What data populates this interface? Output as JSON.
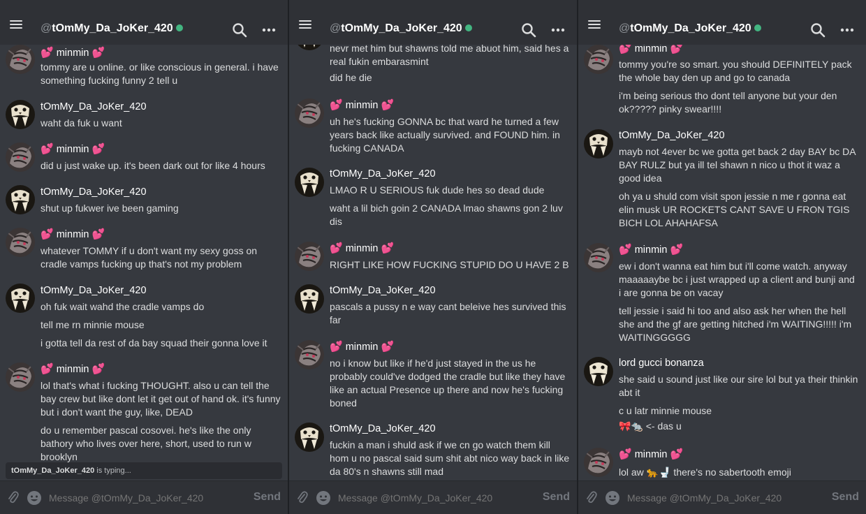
{
  "colors": {
    "background": "#36393f",
    "topbar": "#2f3136",
    "online": "#43b581",
    "heart": "#ff5ab0"
  },
  "header": {
    "at": "@",
    "username": "tOmMy_Da_JoKer_420",
    "status": "online"
  },
  "composer": {
    "placeholder": "Message @tOmMy_Da_JoKer_420",
    "send_label": "Send"
  },
  "panels": [
    {
      "typing": {
        "name": "tOmMy_Da_JoKer_420",
        "text": " is typing..."
      },
      "messages": [
        {
          "author": "minmin",
          "heart": "💕",
          "lines": [
            "tommy are u online. or like conscious in general. i have something fucking funny 2 tell u"
          ]
        },
        {
          "author": "tOmMy_Da_JoKer_420",
          "lines": [
            "waht da fuk u want"
          ]
        },
        {
          "author": "minmin",
          "heart": "💕",
          "lines": [
            "did u just wake up. it's been dark out for like 4 hours"
          ]
        },
        {
          "author": "tOmMy_Da_JoKer_420",
          "lines": [
            "shut up fukwer ive been gaming"
          ]
        },
        {
          "author": "minmin",
          "heart": "💕",
          "lines": [
            "whatever TOMMY if u don't want my sexy goss on cradle vamps fucking up that's not my problem"
          ]
        },
        {
          "author": "tOmMy_Da_JoKer_420",
          "lines": [
            "oh fuk wait wahd the cradle vamps do",
            "tell me rn minnie mouse",
            "i gotta tell da rest of da bay squad their gonna love it"
          ]
        },
        {
          "author": "minmin",
          "heart": "💕",
          "lines": [
            "lol that's what i fucking THOUGHT. also u can tell the bay crew but like dont let it get out of hand ok. it's funny but i don't want the guy, like, DEAD",
            "do u remember pascal cosovei. he's like the only bathory who lives over here, short, used to run w brooklyn"
          ]
        }
      ]
    },
    {
      "messages": [
        {
          "author": "",
          "lines": [
            "nevr met him but shawns told me abuot him, said hes a real fukin embarasmint",
            "did he die"
          ]
        },
        {
          "author": "minmin",
          "heart": "💕",
          "lines": [
            "uh he's fucking GONNA bc that ward he turned a few years back like actually survived. and FOUND him. in fucking CANADA"
          ]
        },
        {
          "author": "tOmMy_Da_JoKer_420",
          "lines": [
            "LMAO R U SERIOUS fuk dude hes so dead dude",
            "waht a lil bich goin 2 CANADA lmao shawns gon 2 luv dis"
          ]
        },
        {
          "author": "minmin",
          "heart": "💕",
          "lines": [
            "RIGHT LIKE HOW FUCKING STUPID DO U HAVE 2 B"
          ]
        },
        {
          "author": "tOmMy_Da_JoKer_420",
          "lines": [
            "pascals a pussy n e way cant beleive hes survived this far"
          ]
        },
        {
          "author": "minmin",
          "heart": "💕",
          "lines": [
            "no i know but like if he'd just stayed in the us he probably could've dodged the cradle but like they have like an actual Presence up there and now he's fucking boned"
          ]
        },
        {
          "author": "tOmMy_Da_JoKer_420",
          "lines": [
            "fuckin a man i shuld ask if we cn go watch them kill hom u no pascal said sum shit abt nico way back in like da 80's n shawns still mad"
          ]
        }
      ]
    },
    {
      "messages": [
        {
          "author": "minmin",
          "heart": "💕",
          "lines": [
            "tommy you're so smart. you should DEFINITELY pack the whole bay den up and go to canada",
            "i'm being serious tho dont tell anyone but your den ok????? pinky swear!!!!"
          ]
        },
        {
          "author": "tOmMy_Da_JoKer_420",
          "lines": [
            "mayb not 4ever bc we gotta get back 2 day BAY bc DA BAY RULZ but ya ill tel shawn n nico u thot it waz a good idea",
            "oh ya u shuld com visit spon jessie n me r gonna eat elin musk UR ROCKETS CANT SAVE U FRON TGIS BICH LOL AHAHAFSA"
          ]
        },
        {
          "author": "minmin",
          "heart": "💕",
          "lines": [
            "ew i don't wanna eat him but i'll come watch. anyway maaaaaybe bc i just wrapped up a client and bunji and i are gonna be on vacay",
            "tell jessie i said hi too and also ask her when the hell she and the gf are getting hitched i'm WAITING!!!!! i'm WAITINGGGGG"
          ]
        },
        {
          "author": "lord gucci bonanza",
          "lines": [
            "she said u sound just like our sire lol but ya their thinkin abt it",
            "c u latr minnie mouse",
            "🎀🐀 <- das u"
          ]
        },
        {
          "author": "minmin",
          "heart": "💕",
          "lines": [
            "lol aw 🐆🚽 there's no sabertooth emoji"
          ]
        }
      ]
    }
  ]
}
